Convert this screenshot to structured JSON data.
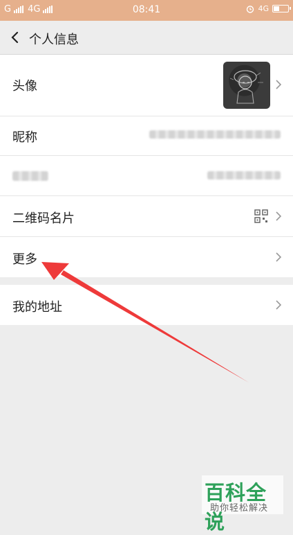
{
  "status_bar": {
    "carrier1": "G",
    "carrier2": "4G",
    "time": "08:41",
    "network": "4G"
  },
  "header": {
    "title": "个人信息"
  },
  "rows": [
    {
      "label": "头像"
    },
    {
      "label": "昵称"
    },
    {
      "label": ""
    },
    {
      "label": "二维码名片"
    },
    {
      "label": "更多"
    },
    {
      "label": "我的地址"
    }
  ],
  "watermark": {
    "title": "百科全说",
    "subtitle": "助你轻松解决"
  },
  "colors": {
    "status_bar": "#e6b08c",
    "arrow": "#ee3a3a",
    "watermark": "#2ea15a"
  }
}
